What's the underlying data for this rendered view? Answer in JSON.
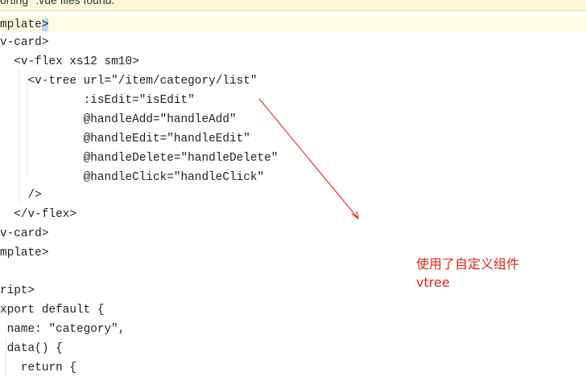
{
  "notification": {
    "text": "orting *.vue files found."
  },
  "code_lines": [
    "mplate",
    "v-card>",
    "  <v-flex xs12 sm10>",
    "    <v-tree url=\"/item/category/list\"",
    "            :isEdit=\"isEdit\"",
    "            @handleAdd=\"handleAdd\"",
    "            @handleEdit=\"handleEdit\"",
    "            @handleDelete=\"handleDelete\"",
    "            @handleClick=\"handleClick\"",
    "    />",
    "  </v-flex>",
    "v-card>",
    "mplate>",
    "",
    "ript>",
    "xport default {",
    " name: \"category\",",
    " data() {",
    "   return {"
  ],
  "highlighted_token": ">",
  "annotation": {
    "line1": "使用了自定义组件",
    "line2": "vtree",
    "color": "#e0251c"
  }
}
